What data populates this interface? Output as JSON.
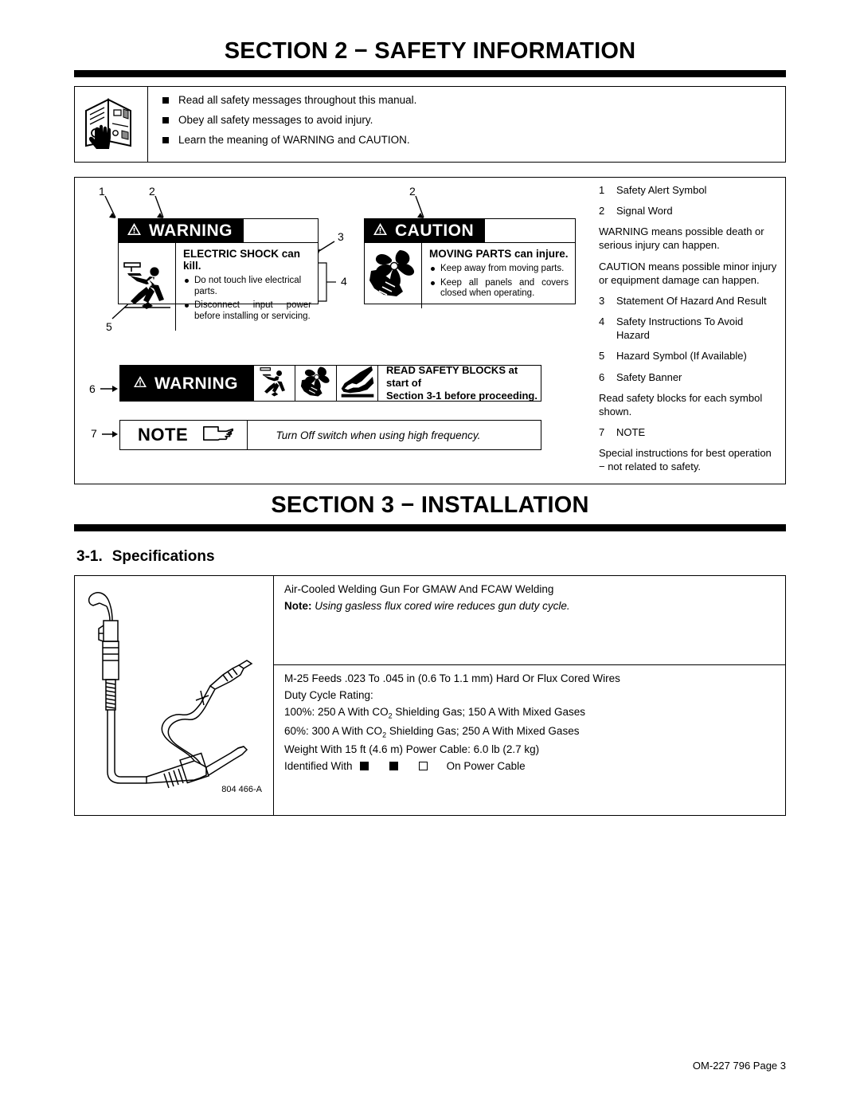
{
  "section2": {
    "title": "SECTION 2 − SAFETY INFORMATION",
    "manual_bullets": [
      "Read all safety messages throughout this manual.",
      "Obey all safety messages to avoid injury.",
      "Learn the meaning of WARNING and CAUTION."
    ]
  },
  "warning_block": {
    "signal_word": "WARNING",
    "statement": "ELECTRIC SHOCK can kill.",
    "instructions": [
      "Do not touch live electrical parts.",
      "Disconnect input power before installing or servicing."
    ]
  },
  "caution_block": {
    "signal_word": "CAUTION",
    "statement": "MOVING PARTS can injure.",
    "instructions": [
      "Keep away from moving parts.",
      "Keep all panels and covers closed when operating."
    ]
  },
  "safety_banner": {
    "signal_word": "WARNING",
    "message_line1": "READ SAFETY BLOCKS at start of",
    "message_line2": "Section 3-1 before proceeding."
  },
  "note_row": {
    "label": "NOTE",
    "text": "Turn Off switch when using high frequency."
  },
  "callouts": {
    "c1": "1",
    "c2": "2",
    "c2b": "2",
    "c3": "3",
    "c4": "4",
    "c5": "5",
    "c6": "6",
    "c7": "7"
  },
  "legend": {
    "items": [
      {
        "num": "1",
        "text": "Safety Alert Symbol"
      },
      {
        "num": "2",
        "text": "Signal Word"
      }
    ],
    "para_warning": "WARNING means possible death or serious injury can happen.",
    "para_caution": "CAUTION means possible minor injury or equipment damage can happen.",
    "items2": [
      {
        "num": "3",
        "text": "Statement Of Hazard And Result"
      },
      {
        "num": "4",
        "text": "Safety Instructions To Avoid Hazard"
      },
      {
        "num": "5",
        "text": "Hazard Symbol (If Available)"
      },
      {
        "num": "6",
        "text": "Safety Banner"
      }
    ],
    "para_read": "Read safety blocks for each symbol shown.",
    "item7": {
      "num": "7",
      "text": "NOTE"
    },
    "para_note": "Special instructions for best operation − not related to safety."
  },
  "section3": {
    "title": "SECTION 3 − INSTALLATION",
    "subhead_num": "3-1.",
    "subhead_text": "Specifications"
  },
  "specs": {
    "part_number": "804 466-A",
    "row_a_line1": "Air-Cooled Welding Gun For GMAW And FCAW Welding",
    "row_a_note_label": "Note:",
    "row_a_note_text": "Using gasless flux cored wire reduces gun duty cycle.",
    "row_b_line1": "M-25 Feeds .023 To .045 in (0.6 To 1.1 mm) Hard Or Flux Cored Wires",
    "row_b_line2": "Duty Cycle Rating:",
    "row_b_line3_pre": "100%: 250 A With CO",
    "row_b_line3_sub": "2",
    "row_b_line3_post": " Shielding Gas; 150 A With Mixed Gases",
    "row_b_line4_pre": "60%: 300 A With CO",
    "row_b_line4_sub": "2",
    "row_b_line4_post": " Shielding Gas; 250 A With Mixed Gases",
    "row_b_line5": "Weight With 15 ft (4.6 m) Power Cable: 6.0 lb (2.7 kg)",
    "row_b_line6_pre": "Identified With",
    "row_b_line6_post": "On Power Cable"
  },
  "footer": "OM-227 796 Page 3"
}
